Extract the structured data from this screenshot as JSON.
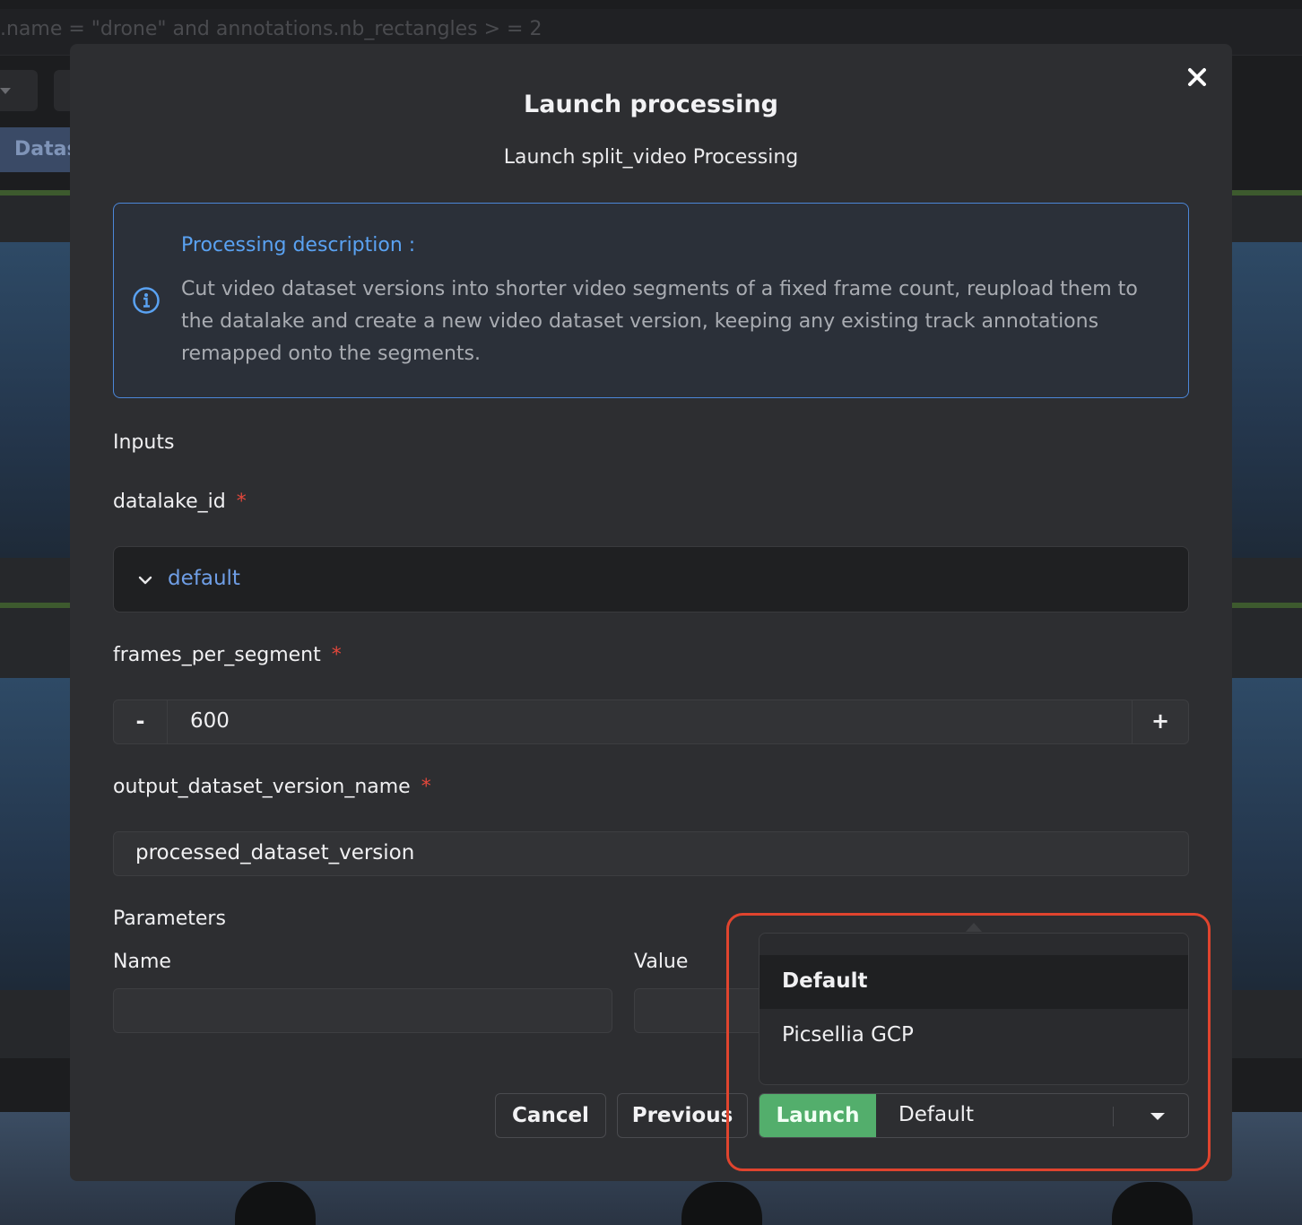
{
  "background": {
    "query_text": ".name = \"drone\" and annotations.nb_rectangles > = 2",
    "tab_label": "Datas"
  },
  "modal": {
    "title": "Launch processing",
    "subtitle": "Launch split_video Processing",
    "description": {
      "title": "Processing description :",
      "text": "Cut video dataset versions into shorter video segments of a fixed frame count, reupload them to the datalake and create a new video dataset version, keeping any existing track annotations remapped onto the segments."
    },
    "inputs_heading": "Inputs",
    "fields": {
      "datalake_id": {
        "label": "datalake_id",
        "required_mark": "*",
        "value": "default"
      },
      "frames_per_segment": {
        "label": "frames_per_segment",
        "required_mark": "*",
        "value": "600",
        "minus": "-",
        "plus": "+"
      },
      "output_dataset_version_name": {
        "label": "output_dataset_version_name",
        "required_mark": "*",
        "value": "processed_dataset_version"
      }
    },
    "parameters": {
      "heading": "Parameters",
      "name_label": "Name",
      "value_label": "Value"
    },
    "buttons": {
      "cancel": "Cancel",
      "previous": "Previous",
      "launch": "Launch"
    },
    "target_select": {
      "selected": "Default",
      "options": [
        "Default",
        "Picsellia GCP"
      ]
    }
  },
  "colors": {
    "accent": "#5aa2f2",
    "launch": "#53ae6c",
    "required": "#e3473b",
    "highlight": "#e0442e"
  }
}
